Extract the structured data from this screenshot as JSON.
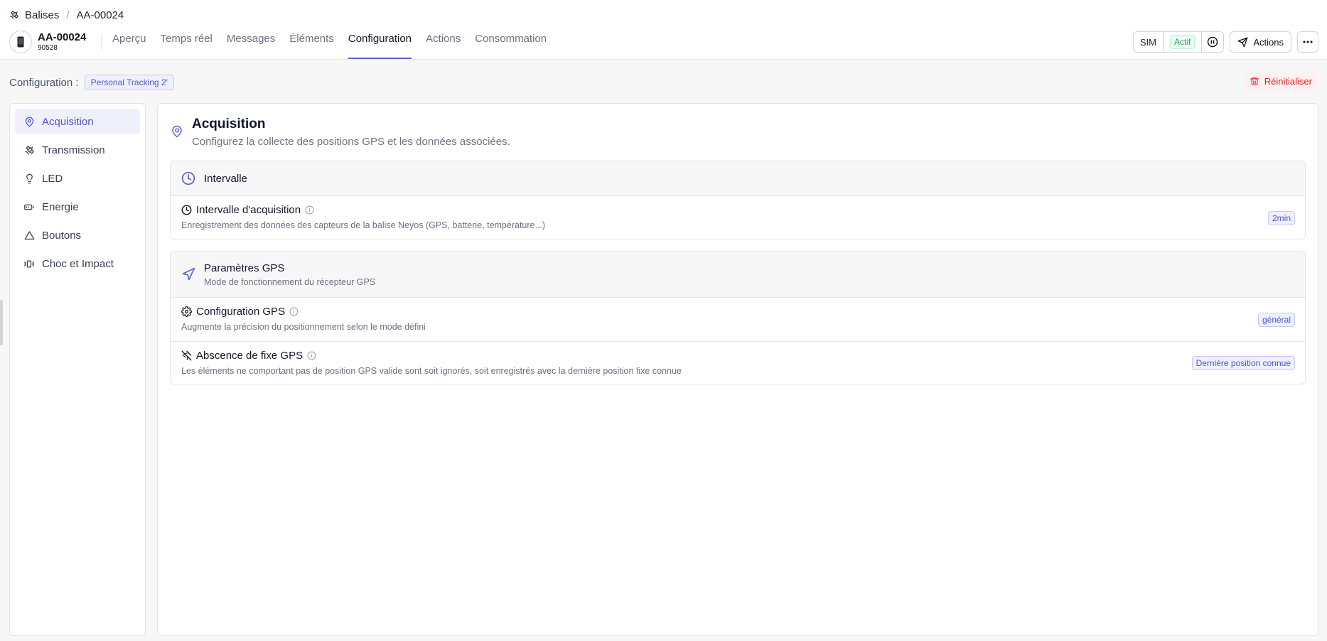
{
  "breadcrumb": {
    "root": "Balises",
    "current": "AA-00024"
  },
  "device": {
    "name": "AA-00024",
    "serial": "90528"
  },
  "tabs": [
    "Aperçu",
    "Temps réel",
    "Messages",
    "Éléments",
    "Configuration",
    "Actions",
    "Consommation"
  ],
  "active_tab": "Configuration",
  "header_actions": {
    "sim": "SIM",
    "status": "Actif",
    "actions": "Actions"
  },
  "config_bar": {
    "label": "Configuration :",
    "profile": "Personal Tracking 2'",
    "reset": "Réinitialiser"
  },
  "sidebar": {
    "active": "Acquisition",
    "items": [
      {
        "label": "Acquisition",
        "icon": "map-pin-icon"
      },
      {
        "label": "Transmission",
        "icon": "satellite-icon"
      },
      {
        "label": "LED",
        "icon": "lightbulb-icon"
      },
      {
        "label": "Energie",
        "icon": "battery-icon"
      },
      {
        "label": "Boutons",
        "icon": "triangle-icon"
      },
      {
        "label": "Choc et Impact",
        "icon": "vibrate-icon"
      }
    ]
  },
  "section": {
    "title": "Acquisition",
    "description": "Configurez la collecte des positions GPS et les données associées."
  },
  "cards": {
    "intervalle": {
      "title": "Intervalle",
      "settings": [
        {
          "title": "Intervalle d'acquisition",
          "description": "Enregistrement des données des capteurs de la balise Neyos (GPS, batterie, température...)",
          "value": "2min"
        }
      ]
    },
    "gps": {
      "title": "Paramètres GPS",
      "subtitle": "Mode de fonctionnement du récepteur GPS",
      "settings": [
        {
          "title": "Configuration GPS",
          "description": "Augmente la précision du positionnement selon le mode défini",
          "value": "général"
        },
        {
          "title": "Abscence de fixe GPS",
          "description": "Les éléments ne comportant pas de position GPS valide sont soit ignorés, soit enregistrés avec la dernière position fixe connue",
          "value": "Dernière position connue"
        }
      ]
    }
  },
  "colors": {
    "accent": "#5b63d3",
    "danger": "#dc2626",
    "success": "#22a35a"
  }
}
